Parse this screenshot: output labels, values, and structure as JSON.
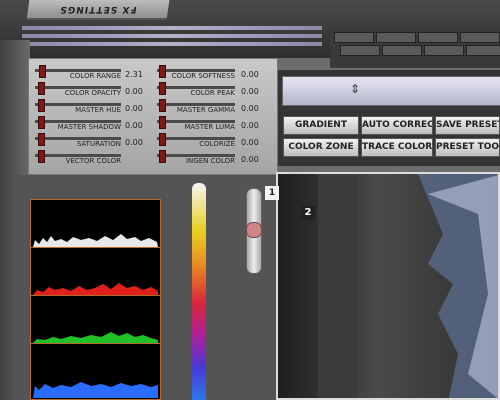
{
  "window": {
    "tab_title": "FX SETTINGS"
  },
  "sliders_left": [
    {
      "label": "COLOR RANGE",
      "value": "2.31",
      "level": 0.05
    },
    {
      "label": "COLOR OPACITY",
      "value": "0.00",
      "level": 0.03
    },
    {
      "label": "MASTER HUE",
      "value": "0.00",
      "level": 0.03
    },
    {
      "label": "MASTER SHADOW",
      "value": "0.00",
      "level": 0.03
    },
    {
      "label": "SATURATION",
      "value": "0.00",
      "level": 0.03
    },
    {
      "label": "VECTOR COLOR",
      "value": "",
      "level": 0.03
    }
  ],
  "sliders_right": [
    {
      "label": "COLOR SOFTNESS",
      "value": "0.00",
      "level": 0.03
    },
    {
      "label": "COLOR PEAK",
      "value": "0.00",
      "level": 0.03
    },
    {
      "label": "MASTER GAMMA",
      "value": "0.00",
      "level": 0.03
    },
    {
      "label": "MASTER LUMA",
      "value": "0.00",
      "level": 0.03
    },
    {
      "label": "COLORIZE",
      "value": "0.00",
      "level": 0.03
    },
    {
      "label": "INGEN COLOR",
      "value": "0.00",
      "level": 0.03
    }
  ],
  "buttons": {
    "gradient": "GRADIENT",
    "auto_correct": "AUTO CORRECT",
    "save_preset": "SAVE PRESET",
    "color_zone": "COLOR ZONE",
    "trace_color": "TRACE COLOR",
    "preset_tool": "PRESET TOOL"
  },
  "viewer": {
    "marker_1": "1",
    "marker_2": "2"
  },
  "histogram": {
    "channels": [
      "luma",
      "red",
      "green",
      "blue"
    ],
    "colors": [
      "#e8e8e8",
      "#e0201a",
      "#22c028",
      "#2a6cff"
    ]
  },
  "icons": {
    "timeline_marker": "playhead-icon"
  }
}
